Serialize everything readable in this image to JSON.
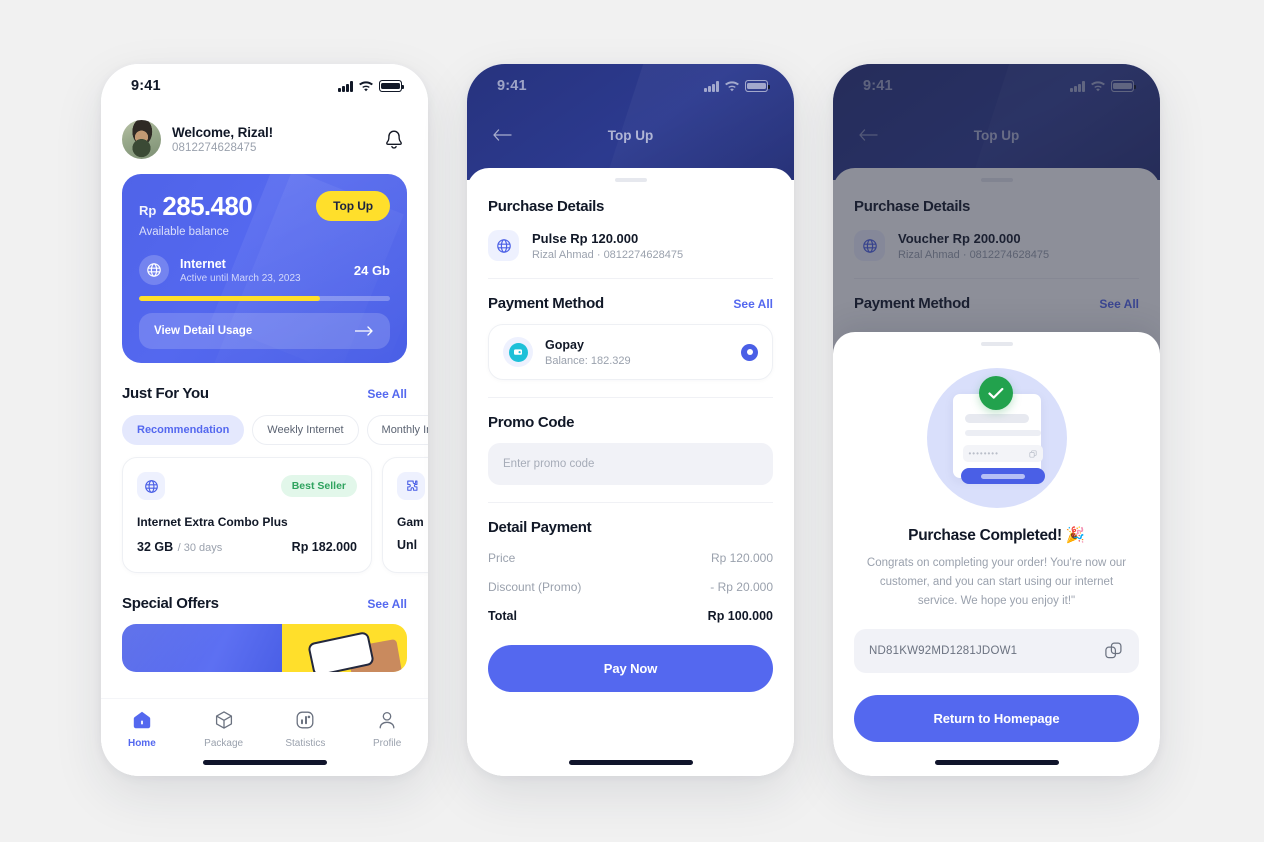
{
  "statusbar": {
    "time": "9:41"
  },
  "home": {
    "greeting": {
      "name": "Welcome, Rizal!",
      "phone": "0812274628475"
    },
    "balance": {
      "currency": "Rp",
      "amount": "285.480",
      "label": "Available balance",
      "topup_label": "Top Up",
      "internet_title": "Internet",
      "internet_until": "Active until March 23, 2023",
      "internet_quota": "24 Gb",
      "progress_percent": 72,
      "detail_label": "View Detail Usage"
    },
    "just_for_you": {
      "title": "Just For You",
      "see_all": "See All",
      "chips": [
        "Recommendation",
        "Weekly Internet",
        "Monthly Internet"
      ],
      "packages": [
        {
          "name": "Internet Extra Combo Plus",
          "badge": "Best Seller",
          "quota": "32 GB",
          "days": "/ 30 days",
          "price": "Rp 182.000",
          "icon": "globe-icon"
        },
        {
          "name": "Gam",
          "badge": "",
          "quota": "Unl",
          "days": "",
          "price": "",
          "icon": "puzzle-icon"
        }
      ]
    },
    "special_offers": {
      "title": "Special Offers",
      "see_all": "See All"
    },
    "tabbar": [
      {
        "label": "Home",
        "icon": "home-icon",
        "active": true
      },
      {
        "label": "Package",
        "icon": "box-icon",
        "active": false
      },
      {
        "label": "Statistics",
        "icon": "chart-icon",
        "active": false
      },
      {
        "label": "Profile",
        "icon": "person-icon",
        "active": false
      }
    ]
  },
  "topup": {
    "header_title": "Top Up",
    "purchase_details_title": "Purchase Details",
    "item": {
      "name": "Pulse Rp 120.000",
      "owner": "Rizal Ahmad",
      "separator": "·",
      "phone": "0812274628475"
    },
    "payment_method_title": "Payment Method",
    "payment_see_all": "See All",
    "gopay": {
      "name": "Gopay",
      "balance": "Balance: 182.329"
    },
    "promo": {
      "title": "Promo Code",
      "placeholder": "Enter promo code",
      "value": ""
    },
    "detail_payment_title": "Detail Payment",
    "rows": [
      {
        "label": "Price",
        "value": "Rp 120.000"
      },
      {
        "label": "Discount (Promo)",
        "value": "- Rp 20.000"
      }
    ],
    "total": {
      "label": "Total",
      "value": "Rp 100.000"
    },
    "cta": "Pay Now"
  },
  "success_screen": {
    "header_title": "Top Up",
    "purchase_details_title": "Purchase Details",
    "item": {
      "name": "Voucher Rp 200.000",
      "owner": "Rizal Ahmad",
      "separator": "·",
      "phone": "0812274628475"
    },
    "payment_method_title": "Payment Method",
    "payment_see_all": "See All",
    "modal": {
      "title": "Purchase Completed! 🎉",
      "description": "Congrats on completing your order! You're now our customer, and you can start using our internet service. We hope you enjoy it!\"",
      "voucher_code": "ND81KW92MD1281JDOW1",
      "cta": "Return to Homepage"
    }
  },
  "colors": {
    "primary": "#5468ef",
    "navy": "#2c3a8f",
    "yellow": "#ffdf2b",
    "green": "#22a24d",
    "page_bg": "#f1f1f1"
  }
}
